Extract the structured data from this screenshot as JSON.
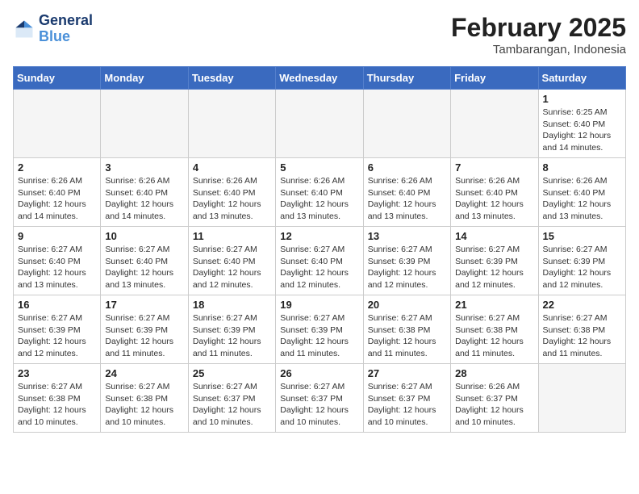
{
  "header": {
    "logo_line1": "General",
    "logo_line2": "Blue",
    "month_title": "February 2025",
    "location": "Tambarangan, Indonesia"
  },
  "weekdays": [
    "Sunday",
    "Monday",
    "Tuesday",
    "Wednesday",
    "Thursday",
    "Friday",
    "Saturday"
  ],
  "weeks": [
    [
      {
        "day": "",
        "info": ""
      },
      {
        "day": "",
        "info": ""
      },
      {
        "day": "",
        "info": ""
      },
      {
        "day": "",
        "info": ""
      },
      {
        "day": "",
        "info": ""
      },
      {
        "day": "",
        "info": ""
      },
      {
        "day": "1",
        "info": "Sunrise: 6:25 AM\nSunset: 6:40 PM\nDaylight: 12 hours\nand 14 minutes."
      }
    ],
    [
      {
        "day": "2",
        "info": "Sunrise: 6:26 AM\nSunset: 6:40 PM\nDaylight: 12 hours\nand 14 minutes."
      },
      {
        "day": "3",
        "info": "Sunrise: 6:26 AM\nSunset: 6:40 PM\nDaylight: 12 hours\nand 14 minutes."
      },
      {
        "day": "4",
        "info": "Sunrise: 6:26 AM\nSunset: 6:40 PM\nDaylight: 12 hours\nand 13 minutes."
      },
      {
        "day": "5",
        "info": "Sunrise: 6:26 AM\nSunset: 6:40 PM\nDaylight: 12 hours\nand 13 minutes."
      },
      {
        "day": "6",
        "info": "Sunrise: 6:26 AM\nSunset: 6:40 PM\nDaylight: 12 hours\nand 13 minutes."
      },
      {
        "day": "7",
        "info": "Sunrise: 6:26 AM\nSunset: 6:40 PM\nDaylight: 12 hours\nand 13 minutes."
      },
      {
        "day": "8",
        "info": "Sunrise: 6:26 AM\nSunset: 6:40 PM\nDaylight: 12 hours\nand 13 minutes."
      }
    ],
    [
      {
        "day": "9",
        "info": "Sunrise: 6:27 AM\nSunset: 6:40 PM\nDaylight: 12 hours\nand 13 minutes."
      },
      {
        "day": "10",
        "info": "Sunrise: 6:27 AM\nSunset: 6:40 PM\nDaylight: 12 hours\nand 13 minutes."
      },
      {
        "day": "11",
        "info": "Sunrise: 6:27 AM\nSunset: 6:40 PM\nDaylight: 12 hours\nand 12 minutes."
      },
      {
        "day": "12",
        "info": "Sunrise: 6:27 AM\nSunset: 6:40 PM\nDaylight: 12 hours\nand 12 minutes."
      },
      {
        "day": "13",
        "info": "Sunrise: 6:27 AM\nSunset: 6:39 PM\nDaylight: 12 hours\nand 12 minutes."
      },
      {
        "day": "14",
        "info": "Sunrise: 6:27 AM\nSunset: 6:39 PM\nDaylight: 12 hours\nand 12 minutes."
      },
      {
        "day": "15",
        "info": "Sunrise: 6:27 AM\nSunset: 6:39 PM\nDaylight: 12 hours\nand 12 minutes."
      }
    ],
    [
      {
        "day": "16",
        "info": "Sunrise: 6:27 AM\nSunset: 6:39 PM\nDaylight: 12 hours\nand 12 minutes."
      },
      {
        "day": "17",
        "info": "Sunrise: 6:27 AM\nSunset: 6:39 PM\nDaylight: 12 hours\nand 11 minutes."
      },
      {
        "day": "18",
        "info": "Sunrise: 6:27 AM\nSunset: 6:39 PM\nDaylight: 12 hours\nand 11 minutes."
      },
      {
        "day": "19",
        "info": "Sunrise: 6:27 AM\nSunset: 6:39 PM\nDaylight: 12 hours\nand 11 minutes."
      },
      {
        "day": "20",
        "info": "Sunrise: 6:27 AM\nSunset: 6:38 PM\nDaylight: 12 hours\nand 11 minutes."
      },
      {
        "day": "21",
        "info": "Sunrise: 6:27 AM\nSunset: 6:38 PM\nDaylight: 12 hours\nand 11 minutes."
      },
      {
        "day": "22",
        "info": "Sunrise: 6:27 AM\nSunset: 6:38 PM\nDaylight: 12 hours\nand 11 minutes."
      }
    ],
    [
      {
        "day": "23",
        "info": "Sunrise: 6:27 AM\nSunset: 6:38 PM\nDaylight: 12 hours\nand 10 minutes."
      },
      {
        "day": "24",
        "info": "Sunrise: 6:27 AM\nSunset: 6:38 PM\nDaylight: 12 hours\nand 10 minutes."
      },
      {
        "day": "25",
        "info": "Sunrise: 6:27 AM\nSunset: 6:37 PM\nDaylight: 12 hours\nand 10 minutes."
      },
      {
        "day": "26",
        "info": "Sunrise: 6:27 AM\nSunset: 6:37 PM\nDaylight: 12 hours\nand 10 minutes."
      },
      {
        "day": "27",
        "info": "Sunrise: 6:27 AM\nSunset: 6:37 PM\nDaylight: 12 hours\nand 10 minutes."
      },
      {
        "day": "28",
        "info": "Sunrise: 6:26 AM\nSunset: 6:37 PM\nDaylight: 12 hours\nand 10 minutes."
      },
      {
        "day": "",
        "info": ""
      }
    ]
  ]
}
